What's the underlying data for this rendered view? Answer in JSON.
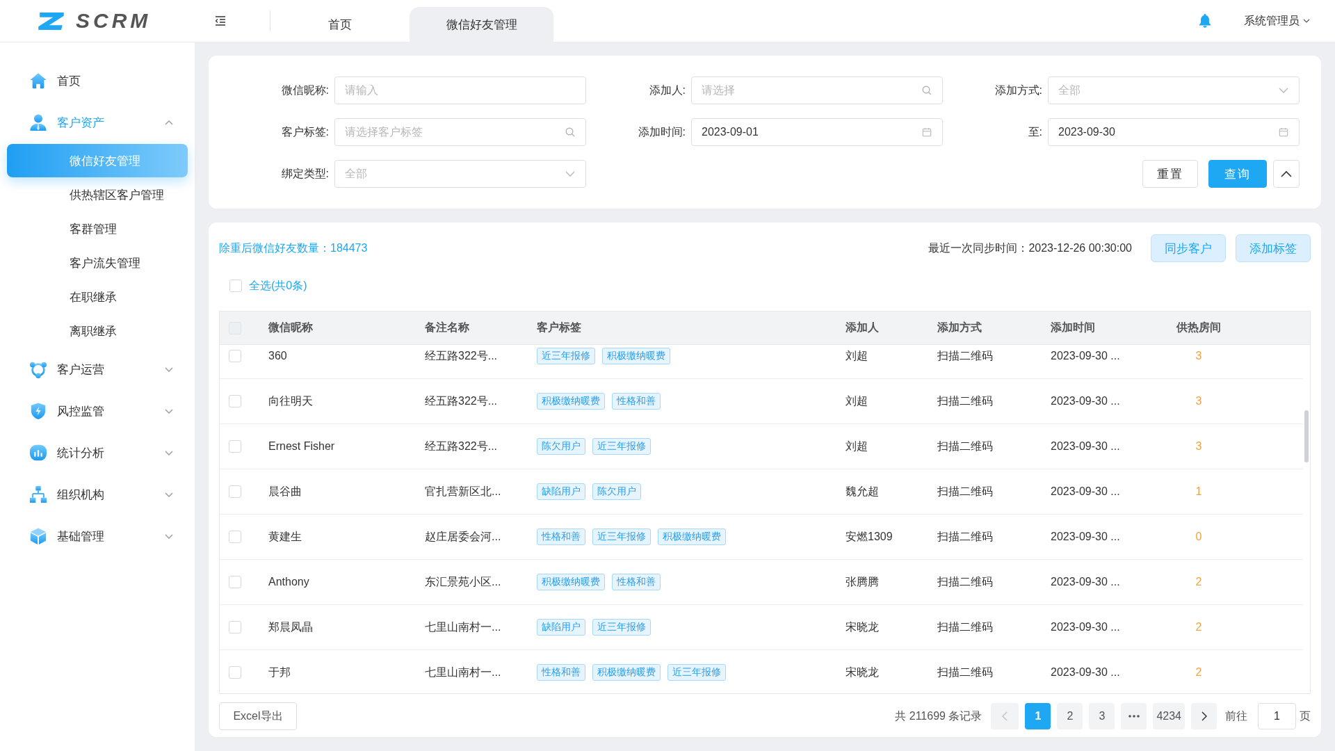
{
  "logo": {
    "text": "SCRM"
  },
  "header": {
    "tabs": [
      {
        "label": "首页",
        "selected": false
      },
      {
        "label": "微信好友管理",
        "selected": true
      }
    ],
    "user": "系统管理员"
  },
  "sidebar": {
    "items": [
      {
        "kind": "link",
        "label": "首页",
        "selected": false
      },
      {
        "kind": "group",
        "label": "客户资产",
        "expanded": true,
        "children": [
          {
            "label": "微信好友管理",
            "selected": true
          },
          {
            "label": "供热辖区客户管理",
            "selected": false
          },
          {
            "label": "客群管理",
            "selected": false
          },
          {
            "label": "客户流失管理",
            "selected": false
          },
          {
            "label": "在职继承",
            "selected": false
          },
          {
            "label": "离职继承",
            "selected": false
          }
        ]
      },
      {
        "kind": "group",
        "label": "客户运营",
        "expanded": false
      },
      {
        "kind": "group",
        "label": "风控监管",
        "expanded": false
      },
      {
        "kind": "group",
        "label": "统计分析",
        "expanded": false
      },
      {
        "kind": "group",
        "label": "组织机构",
        "expanded": false
      },
      {
        "kind": "group",
        "label": "基础管理",
        "expanded": false
      }
    ]
  },
  "filters": {
    "fields": [
      {
        "label": "微信昵称:",
        "kind": "text",
        "placeholder": "请输入"
      },
      {
        "label": "添加人:",
        "kind": "search",
        "placeholder": "请选择"
      },
      {
        "label": "添加方式:",
        "kind": "select",
        "placeholder": "全部"
      },
      {
        "label": "客户标签:",
        "kind": "search",
        "placeholder": "请选择客户标签"
      },
      {
        "label": "添加时间:",
        "kind": "date",
        "value": "2023-09-01"
      },
      {
        "label": "至:",
        "kind": "date",
        "value": "2023-09-30"
      },
      {
        "label": "绑定类型:",
        "kind": "select",
        "placeholder": "全部"
      }
    ],
    "buttons": [
      {
        "label": "重置",
        "kind": "default"
      },
      {
        "label": "查询",
        "kind": "primary"
      }
    ],
    "expanded": true
  },
  "summary": {
    "label": "除重后微信好友数量：",
    "value": "184473"
  },
  "sync_time": "最近一次同步时间：2023-12-26 00:30:00",
  "actions": [
    "同步客户",
    "添加标签"
  ],
  "select_all": {
    "label": "全选(共0条)",
    "checked": false
  },
  "table": {
    "header_checkbox": {
      "checked": false,
      "disabled": true
    },
    "columns": [
      "微信昵称",
      "备注名称",
      "客户标签",
      "添加人",
      "添加方式",
      "添加时间",
      "供热房间"
    ],
    "rows": [
      {
        "checked": false,
        "nickname": "360",
        "remark": "经五路322号...",
        "tags": [
          "近三年报修",
          "积极缴纳暖费"
        ],
        "added_by": "刘超",
        "method": "扫描二维码",
        "added_at": "2023-09-30 ...",
        "rooms": "3"
      },
      {
        "checked": false,
        "nickname": "向往明天",
        "remark": "经五路322号...",
        "tags": [
          "积极缴纳暖费",
          "性格和善"
        ],
        "added_by": "刘超",
        "method": "扫描二维码",
        "added_at": "2023-09-30 ...",
        "rooms": "3"
      },
      {
        "checked": false,
        "nickname": "Ernest Fisher",
        "remark": "经五路322号...",
        "tags": [
          "陈欠用户",
          "近三年报修"
        ],
        "added_by": "刘超",
        "method": "扫描二维码",
        "added_at": "2023-09-30 ...",
        "rooms": "3"
      },
      {
        "checked": false,
        "nickname": "晨谷曲",
        "remark": "官扎营新区北...",
        "tags": [
          "缺陷用户",
          "陈欠用户"
        ],
        "added_by": "魏允超",
        "method": "扫描二维码",
        "added_at": "2023-09-30 ...",
        "rooms": "1"
      },
      {
        "checked": false,
        "nickname": "黄建生",
        "remark": "赵庄居委会河...",
        "tags": [
          "性格和善",
          "近三年报修",
          "积极缴纳暖费"
        ],
        "added_by": "安燃1309",
        "method": "扫描二维码",
        "added_at": "2023-09-30 ...",
        "rooms": "0"
      },
      {
        "checked": false,
        "nickname": "Anthony",
        "remark": "东汇景苑小区...",
        "tags": [
          "积极缴纳暖费",
          "性格和善"
        ],
        "added_by": "张腾腾",
        "method": "扫描二维码",
        "added_at": "2023-09-30 ...",
        "rooms": "2"
      },
      {
        "checked": false,
        "nickname": "郑晨凤晶",
        "remark": "七里山南村一...",
        "tags": [
          "缺陷用户",
          "近三年报修"
        ],
        "added_by": "宋晓龙",
        "method": "扫描二维码",
        "added_at": "2023-09-30 ...",
        "rooms": "2"
      },
      {
        "checked": false,
        "nickname": "于邦",
        "remark": "七里山南村一...",
        "tags": [
          "性格和善",
          "积极缴纳暖费",
          "近三年报修"
        ],
        "added_by": "宋晓龙",
        "method": "扫描二维码",
        "added_at": "2023-09-30 ...",
        "rooms": "2"
      }
    ]
  },
  "pagination": {
    "export_label": "Excel导出",
    "total": "共 211699 条记录",
    "prev_disabled": true,
    "next_disabled": false,
    "pages": [
      {
        "kind": "page",
        "label": "1",
        "selected": true
      },
      {
        "kind": "page",
        "label": "2",
        "selected": false
      },
      {
        "kind": "page",
        "label": "3",
        "selected": false
      },
      {
        "kind": "more",
        "selected": false
      },
      {
        "kind": "page",
        "label": "4234",
        "selected": false
      }
    ],
    "goto_label": "前往",
    "goto_value": "1",
    "goto_suffix": "页"
  }
}
